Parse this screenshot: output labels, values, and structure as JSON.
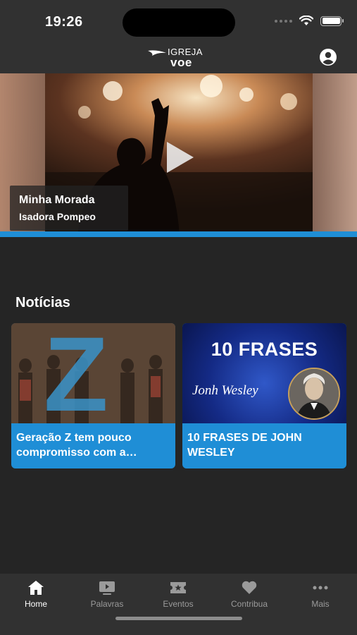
{
  "status": {
    "time": "19:26"
  },
  "header": {
    "logo_line1": "IGREJA",
    "logo_line2": "voe"
  },
  "hero": {
    "title": "Minha Morada",
    "subtitle": "Isadora Pompeo"
  },
  "news": {
    "title": "Notícias",
    "cards": [
      {
        "label": "Geração Z tem pouco compromisso com a…"
      },
      {
        "label": "10 FRASES DE JOHN WESLEY",
        "image_title": "10 FRASES",
        "image_name": "Jonh Wesley"
      }
    ]
  },
  "tabbar": {
    "items": [
      {
        "label": "Home",
        "icon": "home-icon",
        "active": true
      },
      {
        "label": "Palavras",
        "icon": "video-icon"
      },
      {
        "label": "Eventos",
        "icon": "ticket-icon"
      },
      {
        "label": "Contribua",
        "icon": "heart-icon"
      },
      {
        "label": "Mais",
        "icon": "more-icon"
      }
    ]
  },
  "colors": {
    "accent": "#1f8ed6",
    "background": "#252525",
    "bar": "#313131"
  }
}
